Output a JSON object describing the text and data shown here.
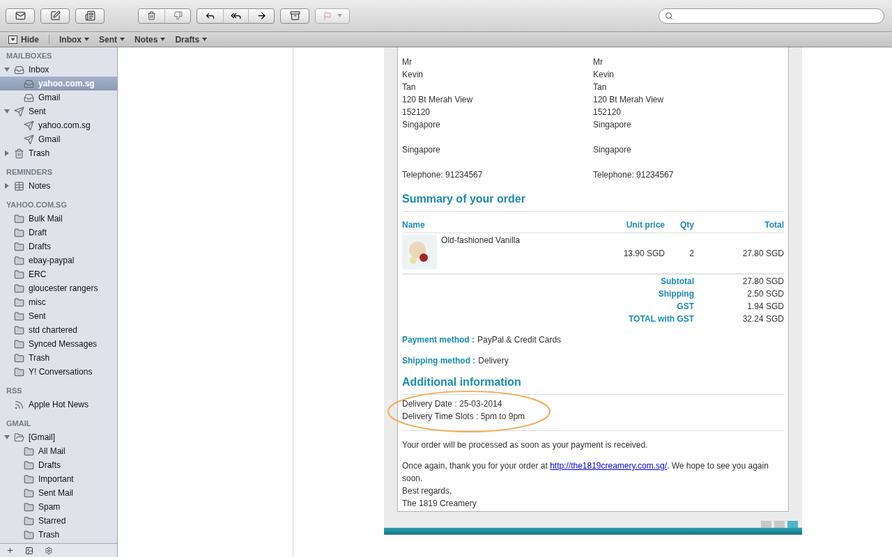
{
  "favorites_bar": {
    "hide": "Hide",
    "items": [
      {
        "label": "Inbox"
      },
      {
        "label": "Sent"
      },
      {
        "label": "Notes"
      },
      {
        "label": "Drafts"
      }
    ]
  },
  "sidebar": {
    "sections": [
      {
        "title": "MAILBOXES",
        "items": [
          {
            "label": "Inbox",
            "kind": "inbox",
            "selected": false,
            "expanded": true,
            "children": [
              {
                "label": "yahoo.com.sg",
                "kind": "inbox",
                "selected": true
              },
              {
                "label": "Gmail",
                "kind": "inbox",
                "selected": false
              }
            ]
          },
          {
            "label": "Sent",
            "kind": "sent",
            "selected": false,
            "expanded": true,
            "children": [
              {
                "label": "yahoo.com.sg",
                "kind": "sent",
                "selected": false
              },
              {
                "label": "Gmail",
                "kind": "sent",
                "selected": false
              }
            ]
          },
          {
            "label": "Trash",
            "kind": "trash",
            "selected": false,
            "expanded": false
          }
        ]
      },
      {
        "title": "REMINDERS",
        "items": [
          {
            "label": "Notes",
            "kind": "notes",
            "selected": false,
            "expanded": false
          }
        ]
      },
      {
        "title": "YAHOO.COM.SG",
        "items": [
          {
            "label": "Bulk Mail",
            "kind": "folder",
            "selected": false
          },
          {
            "label": "Draft",
            "kind": "folder",
            "selected": false
          },
          {
            "label": "Drafts",
            "kind": "folder",
            "selected": false
          },
          {
            "label": "ebay-paypal",
            "kind": "folder",
            "selected": false
          },
          {
            "label": "ERC",
            "kind": "folder",
            "selected": false
          },
          {
            "label": "gloucester rangers",
            "kind": "folder",
            "selected": false
          },
          {
            "label": "misc",
            "kind": "folder",
            "selected": false
          },
          {
            "label": "Sent",
            "kind": "folder",
            "selected": false
          },
          {
            "label": "std chartered",
            "kind": "folder",
            "selected": false
          },
          {
            "label": "Synced Messages",
            "kind": "folder",
            "selected": false
          },
          {
            "label": "Trash",
            "kind": "folder",
            "selected": false
          },
          {
            "label": "Y! Conversations",
            "kind": "folder",
            "selected": false
          }
        ]
      },
      {
        "title": "RSS",
        "items": [
          {
            "label": "Apple Hot News",
            "kind": "rss",
            "selected": false
          }
        ]
      },
      {
        "title": "GMAIL",
        "items": [
          {
            "label": "[Gmail]",
            "kind": "open-folder",
            "selected": false,
            "expanded": true,
            "children": [
              {
                "label": "All Mail",
                "kind": "folder",
                "selected": false
              },
              {
                "label": "Drafts",
                "kind": "folder",
                "selected": false
              },
              {
                "label": "Important",
                "kind": "folder",
                "selected": false
              },
              {
                "label": "Sent Mail",
                "kind": "folder",
                "selected": false
              },
              {
                "label": "Spam",
                "kind": "folder",
                "selected": false
              },
              {
                "label": "Starred",
                "kind": "folder",
                "selected": false
              },
              {
                "label": "Trash",
                "kind": "folder",
                "selected": false
              }
            ]
          }
        ]
      }
    ]
  },
  "email": {
    "addresses": [
      [
        [
          "Mr",
          "Kevin",
          "Tan",
          "120 Bt Merah View",
          "152120",
          "Singapore"
        ],
        [
          "Singapore"
        ],
        [
          "Telephone: 91234567"
        ]
      ],
      [
        [
          "Mr",
          "Kevin",
          "Tan",
          "120 Bt Merah View",
          "152120",
          "Singapore"
        ],
        [
          "Singapore"
        ],
        [
          "Telephone: 91234567"
        ]
      ]
    ],
    "summary_title": "Summary of your order",
    "columns": [
      "Name",
      "Unit price",
      "Qty",
      "Total"
    ],
    "items": [
      {
        "name": "Old-fashioned Vanilla",
        "unit_price": "13.90 SGD",
        "qty": "2",
        "total": "27.80 SGD"
      }
    ],
    "totals": [
      {
        "label": "Subtotal",
        "value": "27.80 SGD"
      },
      {
        "label": "Shipping",
        "value": "2.50 SGD"
      },
      {
        "label": "GST",
        "value": "1.94 SGD"
      },
      {
        "label": "TOTAL with GST",
        "value": "32.24 SGD"
      }
    ],
    "methods": [
      {
        "label": "Payment method :",
        "value": "PayPal & Credit Cards"
      },
      {
        "label": "Shipping method :",
        "value": "Delivery"
      }
    ],
    "additional_title": "Additional information",
    "additional_lines": [
      "Delivery Date : 25-03-2014",
      "Delivery Time Slots : 5pm to 9pm"
    ],
    "processed_note": "Your order will be processed as soon as your payment is received.",
    "thanks": {
      "before": "Once again, thank you for your order at ",
      "link": "http://the1819creamery.com.sg/",
      "after": ". We hope to see you again soon."
    },
    "closing": [
      "Best regards,",
      "The 1819 Creamery"
    ]
  },
  "pager": [
    {
      "selected": false
    },
    {
      "selected": false
    },
    {
      "selected": true
    }
  ]
}
